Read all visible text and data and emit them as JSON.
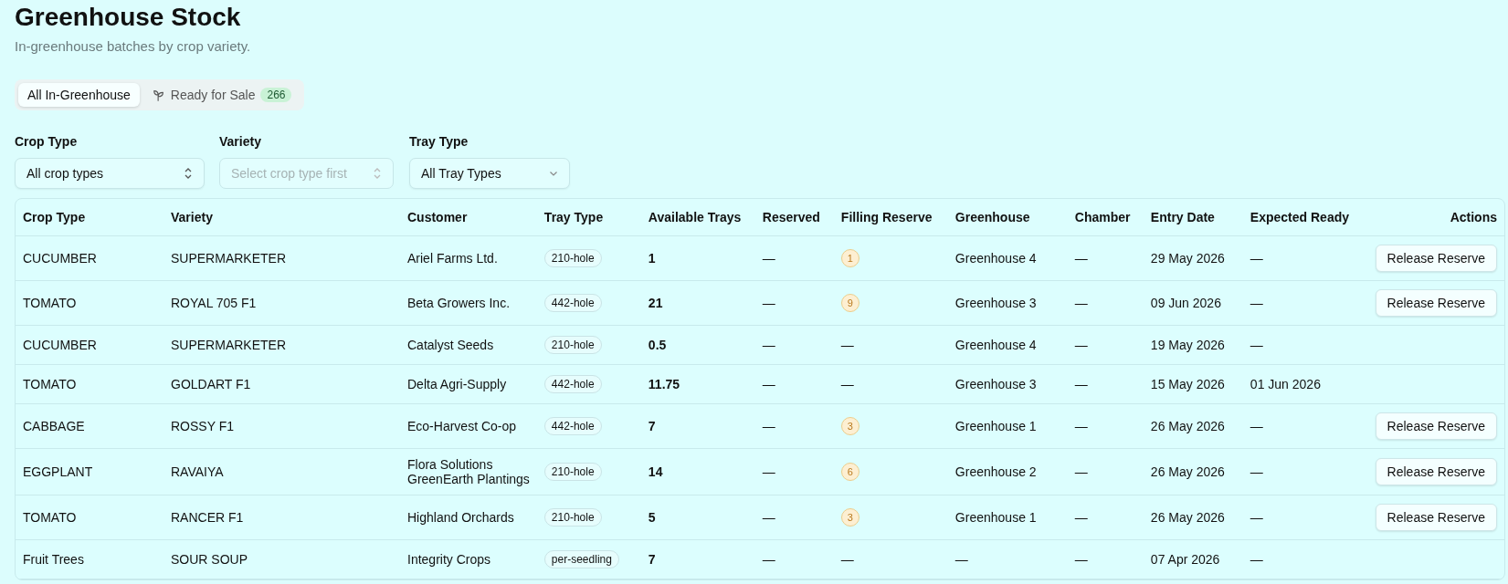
{
  "header": {
    "title": "Greenhouse Stock",
    "subtitle": "In-greenhouse batches by crop variety."
  },
  "tabs": [
    {
      "label": "All In-Greenhouse",
      "selected": true
    },
    {
      "label": "Ready for Sale",
      "selected": false,
      "count": "266",
      "kind": "sprout"
    }
  ],
  "filters": [
    {
      "label": "Crop Type",
      "value": "All crop types",
      "disabled": false,
      "kind": "updown"
    },
    {
      "label": "Variety",
      "placeholder": "Select crop type first",
      "disabled": true,
      "kind": "updown"
    },
    {
      "label": "Tray Type",
      "value": "All Tray Types",
      "disabled": false,
      "kind": "chevron"
    }
  ],
  "table": {
    "columns": [
      "Crop Type",
      "Variety",
      "Customer",
      "Tray Type",
      "Available Trays",
      "Reserved",
      "Filling Reserve",
      "Greenhouse",
      "Chamber",
      "Entry Date",
      "Expected Ready",
      "Actions"
    ],
    "rows": [
      {
        "crop": "CUCUMBER",
        "variety": "SUPERMARKETER",
        "customers": [
          "Ariel Farms Ltd."
        ],
        "tray": "210-hole",
        "available": "1",
        "reserved": "—",
        "filling": {
          "kind": "badge",
          "text": "1"
        },
        "greenhouse": "Greenhouse 4",
        "chamber": "—",
        "entry": "29 May 2026",
        "expected": "—",
        "action": "Release Reserve"
      },
      {
        "crop": "TOMATO",
        "variety": "ROYAL 705 F1",
        "customers": [
          "Beta Growers Inc."
        ],
        "tray": "442-hole",
        "available": "21",
        "reserved": "—",
        "filling": {
          "kind": "badge",
          "text": "9"
        },
        "greenhouse": "Greenhouse 3",
        "chamber": "—",
        "entry": "09 Jun 2026",
        "expected": "—",
        "action": "Release Reserve"
      },
      {
        "crop": "CUCUMBER",
        "variety": "SUPERMARKETER",
        "customers": [
          "Catalyst Seeds"
        ],
        "tray": "210-hole",
        "available": "0.5",
        "reserved": "—",
        "filling": {
          "kind": "dash",
          "text": "—"
        },
        "greenhouse": "Greenhouse 4",
        "chamber": "—",
        "entry": "19 May 2026",
        "expected": "—"
      },
      {
        "crop": "TOMATO",
        "variety": "GOLDART F1",
        "customers": [
          "Delta Agri-Supply"
        ],
        "tray": "442-hole",
        "available": "11.75",
        "reserved": "—",
        "filling": {
          "kind": "dash",
          "text": "—"
        },
        "greenhouse": "Greenhouse 3",
        "chamber": "—",
        "entry": "15 May 2026",
        "expected": "01 Jun 2026"
      },
      {
        "crop": "CABBAGE",
        "variety": "ROSSY F1",
        "customers": [
          "Eco-Harvest Co-op"
        ],
        "tray": "442-hole",
        "available": "7",
        "reserved": "—",
        "filling": {
          "kind": "badge",
          "text": "3"
        },
        "greenhouse": "Greenhouse 1",
        "chamber": "—",
        "entry": "26 May 2026",
        "expected": "—",
        "action": "Release Reserve"
      },
      {
        "crop": "EGGPLANT",
        "variety": "RAVAIYA",
        "customers": [
          "Flora Solutions",
          "GreenEarth Plantings"
        ],
        "tray": "210-hole",
        "available": "14",
        "reserved": "—",
        "filling": {
          "kind": "badge",
          "text": "6"
        },
        "greenhouse": "Greenhouse 2",
        "chamber": "—",
        "entry": "26 May 2026",
        "expected": "—",
        "action": "Release Reserve"
      },
      {
        "crop": "TOMATO",
        "variety": "RANCER F1",
        "customers": [
          "Highland Orchards"
        ],
        "tray": "210-hole",
        "available": "5",
        "reserved": "—",
        "filling": {
          "kind": "badge",
          "text": "3"
        },
        "greenhouse": "Greenhouse 1",
        "chamber": "—",
        "entry": "26 May 2026",
        "expected": "—",
        "action": "Release Reserve"
      },
      {
        "crop": "Fruit Trees",
        "variety": "SOUR SOUP",
        "customers": [
          "Integrity Crops"
        ],
        "tray": "per-seedling",
        "available": "7",
        "reserved": "—",
        "filling": {
          "kind": "dash",
          "text": "—"
        },
        "greenhouse": "—",
        "chamber": "—",
        "entry": "07 Apr 2026",
        "expected": "—"
      }
    ]
  }
}
